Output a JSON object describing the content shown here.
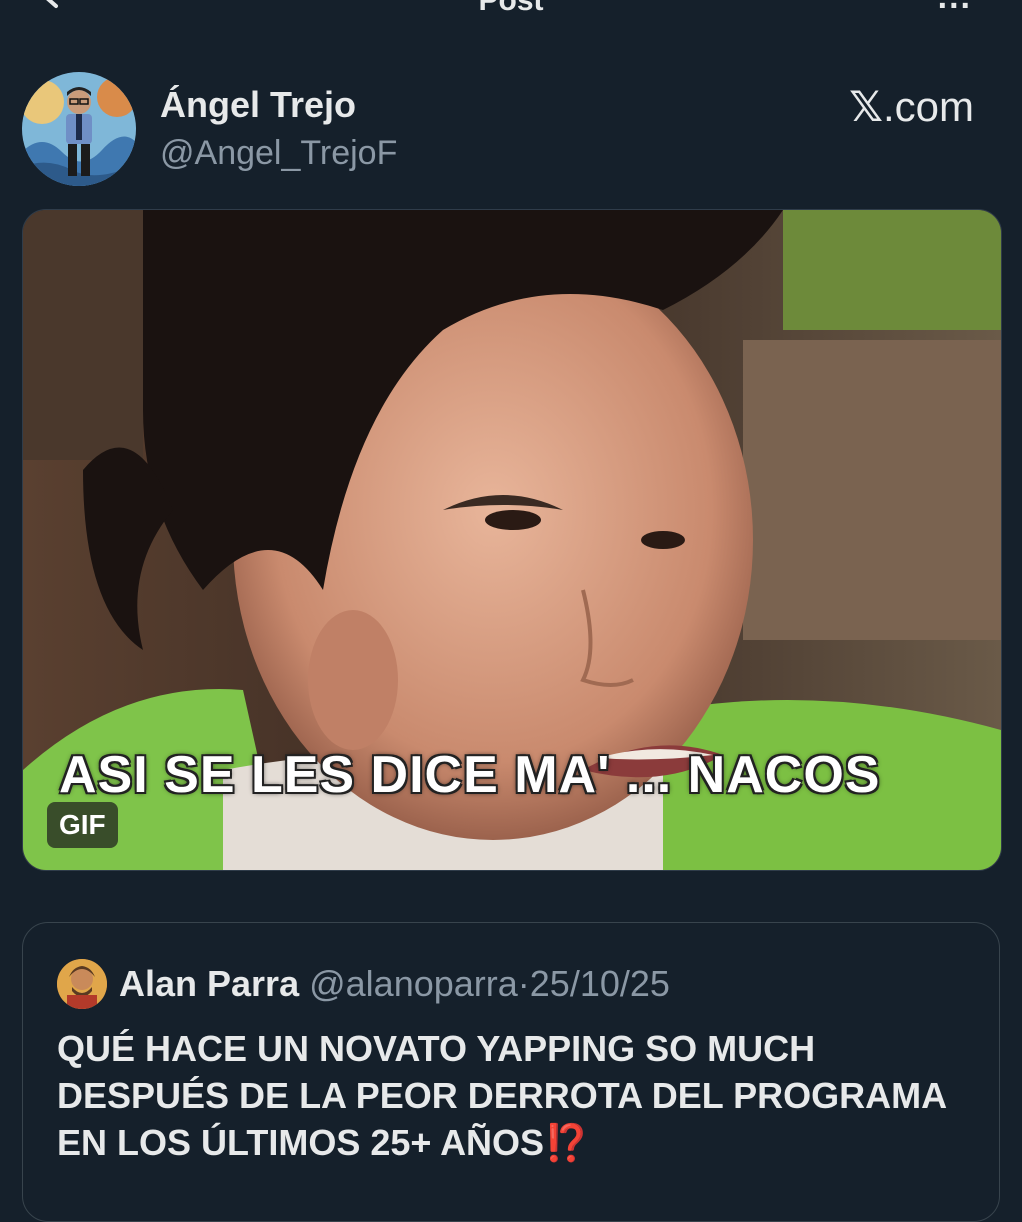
{
  "header": {
    "title": "Post",
    "back_icon": "arrow-left-icon",
    "more_icon": "more-horizontal-icon",
    "more_glyph": "..."
  },
  "post": {
    "author_name": "Ángel Trejo",
    "author_handle": "@Angel_TrejoF",
    "source": {
      "logo_glyph": "𝕏",
      "suffix": ".com"
    },
    "media": {
      "caption": "ASI SE LES DICE MA' ... NACOS",
      "badge": "GIF"
    }
  },
  "quoted_post": {
    "author_name": "Alan Parra",
    "author_handle": "@alanoparra",
    "separator": "·",
    "date": "25/10/25",
    "text": "QUÉ HACE UN NOVATO YAPPING SO MUCH DESPUÉS DE LA PEOR DERROTA DEL PROGRAMA EN LOS ÚLTIMOS 25+ AÑOS",
    "emoji": "⁉️"
  },
  "colors": {
    "background": "#15202b",
    "primary_text": "#e7e9ea",
    "secondary_text": "#8b98a5",
    "border": "#38444d"
  }
}
